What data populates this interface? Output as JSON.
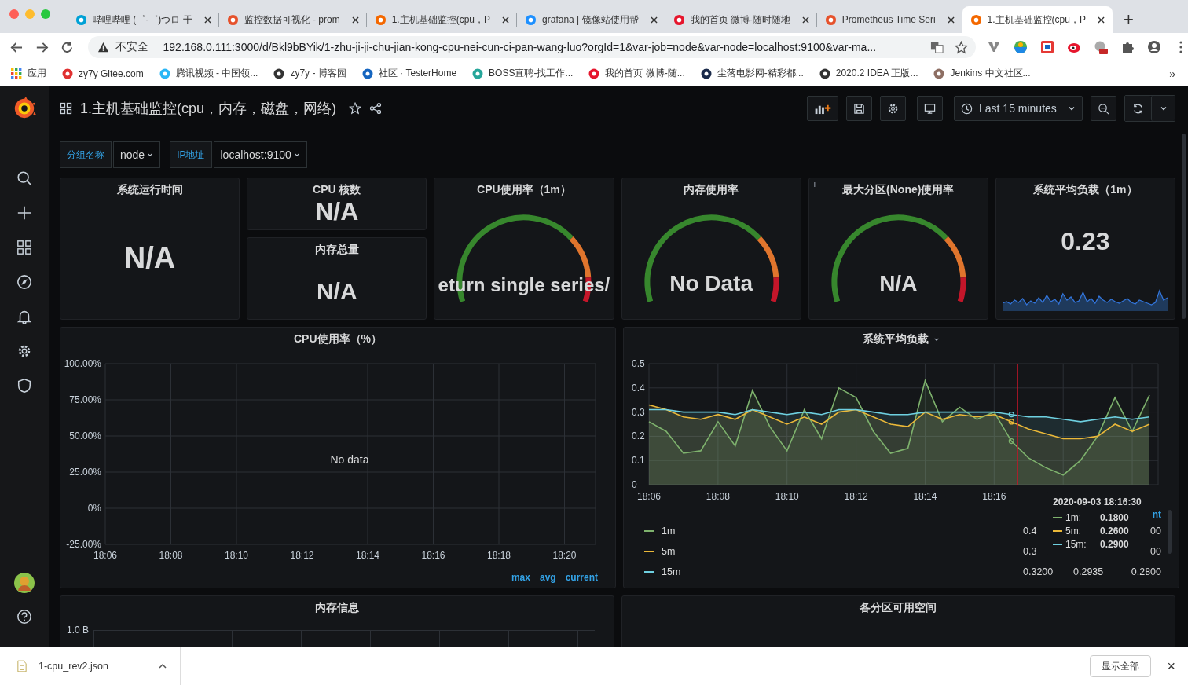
{
  "browser": {
    "tabs": [
      {
        "title": "哔哩哔哩 (゜-゜)つロ 干",
        "selected": false
      },
      {
        "title": "监控数据可视化 - prom",
        "selected": false
      },
      {
        "title": "1.主机基础监控(cpu，P",
        "selected": false
      },
      {
        "title": "grafana | 镜像站使用帮",
        "selected": false
      },
      {
        "title": "我的首页 微博-随时随地",
        "selected": false
      },
      {
        "title": "Prometheus Time Seri",
        "selected": false
      },
      {
        "title": "1.主机基础监控(cpu，P",
        "selected": true
      }
    ],
    "new_tab": "+",
    "address": {
      "security": "不安全",
      "url": "192.168.0.111:3000/d/Bkl9bBYik/1-zhu-ji-ji-chu-jian-kong-cpu-nei-cun-ci-pan-wang-luo?orgId=1&var-job=node&var-node=localhost:9100&var-ma..."
    },
    "bookmarks": [
      "应用",
      "zy7y  Gitee.com",
      "腾讯视频 - 中国领...",
      "zy7y - 博客园",
      "社区 · TesterHome",
      "BOSS直聘-找工作...",
      "我的首页 微博-随...",
      "尘落电影网-精彩都...",
      "2020.2 IDEA 正版...",
      "Jenkins 中文社区..."
    ],
    "bookmarks_more": "»"
  },
  "dashboard": {
    "title": "1.主机基础监控(cpu，内存，磁盘，网络)",
    "time_range": "Last 15 minutes",
    "variables": [
      {
        "label": "分组名称",
        "value": "node"
      },
      {
        "label": "IP地址",
        "value": "localhost:9100"
      }
    ]
  },
  "stat_panels": [
    {
      "kind": "stat",
      "title": "系统运行时间",
      "value": "N/A"
    },
    {
      "kind": "stack",
      "panels": [
        {
          "title": "CPU 核数",
          "value": "N/A"
        },
        {
          "title": "内存总量",
          "value": "N/A"
        }
      ]
    },
    {
      "kind": "gauge",
      "title": "CPU使用率（1m）",
      "value": "eturn single series/"
    },
    {
      "kind": "gauge",
      "title": "内存使用率",
      "value": "No Data"
    },
    {
      "kind": "gauge",
      "title": "最大分区(None)使用率",
      "value": "N/A",
      "info": "i"
    },
    {
      "kind": "sparkline",
      "title": "系统平均负载（1m）",
      "value": "0.23"
    }
  ],
  "cpu_graph": {
    "title": "CPU使用率（%）",
    "message": "No data",
    "legend_headers": [
      "max",
      "avg",
      "current"
    ],
    "chart_data": {
      "type": "line",
      "grid": true,
      "ylim": [
        -25,
        100
      ],
      "yticks": [
        {
          "value": 100,
          "label": "100.00%"
        },
        {
          "value": 75,
          "label": "75.00%"
        },
        {
          "value": 50,
          "label": "50.00%"
        },
        {
          "value": 25,
          "label": "25.00%"
        },
        {
          "value": 0,
          "label": "0%"
        },
        {
          "value": -25,
          "label": "-25.00%"
        }
      ],
      "categories": [
        "18:06",
        "18:08",
        "18:10",
        "18:12",
        "18:14",
        "18:16",
        "18:18",
        "18:20"
      ]
    }
  },
  "load_graph": {
    "title": "系统平均负载",
    "chart_data": {
      "type": "area",
      "grid": true,
      "ylim": [
        0,
        0.5
      ],
      "yticks": [
        0,
        0.1,
        0.2,
        0.3,
        0.4,
        0.5
      ],
      "categories": [
        "18:06",
        null,
        null,
        null,
        "18:08",
        null,
        null,
        null,
        "18:10",
        null,
        null,
        null,
        "18:12",
        null,
        null,
        null,
        "18:14",
        null,
        null,
        null,
        "18:16",
        null,
        null,
        null,
        null,
        null,
        null,
        null,
        null,
        null
      ],
      "series": [
        {
          "name": "1m",
          "color": "#7eb26d",
          "values": [
            0.26,
            0.22,
            0.13,
            0.14,
            0.26,
            0.16,
            0.39,
            0.24,
            0.14,
            0.31,
            0.19,
            0.4,
            0.36,
            0.22,
            0.13,
            0.15,
            0.43,
            0.26,
            0.32,
            0.27,
            0.3,
            0.18,
            0.11,
            0.07,
            0.04,
            0.1,
            0.2,
            0.36,
            0.22,
            0.37
          ]
        },
        {
          "name": "5m",
          "color": "#eab839",
          "values": [
            0.33,
            0.31,
            0.28,
            0.27,
            0.29,
            0.27,
            0.31,
            0.28,
            0.25,
            0.28,
            0.25,
            0.3,
            0.31,
            0.28,
            0.25,
            0.24,
            0.3,
            0.27,
            0.29,
            0.28,
            0.29,
            0.26,
            0.23,
            0.21,
            0.19,
            0.19,
            0.2,
            0.25,
            0.22,
            0.25
          ]
        },
        {
          "name": "15m",
          "color": "#6ed0e0",
          "values": [
            0.31,
            0.31,
            0.3,
            0.3,
            0.3,
            0.29,
            0.31,
            0.3,
            0.29,
            0.3,
            0.29,
            0.31,
            0.31,
            0.3,
            0.29,
            0.29,
            0.3,
            0.3,
            0.3,
            0.3,
            0.3,
            0.29,
            0.28,
            0.28,
            0.27,
            0.26,
            0.27,
            0.28,
            0.27,
            0.28
          ]
        }
      ]
    },
    "legend_header": "nt",
    "legend": [
      {
        "max": "0.4",
        "current": "00"
      },
      {
        "max": "0.3",
        "current": "00"
      },
      {
        "max": "0.3200",
        "avg": "0.2935",
        "current": "0.2800"
      }
    ],
    "tooltip": {
      "time": "2020-09-03 18:16:30",
      "rows": [
        {
          "label": "1m:",
          "value": "0.1800",
          "color": "#7eb26d"
        },
        {
          "label": "5m:",
          "value": "0.2600",
          "color": "#eab839"
        },
        {
          "label": "15m:",
          "value": "0.2900",
          "color": "#6ed0e0"
        }
      ]
    }
  },
  "memory_panel": {
    "title": "内存信息",
    "axis_label": "1.0 B"
  },
  "partition_panel": {
    "title": "各分区可用空间"
  },
  "downloads": {
    "file": "1-cpu_rev2.json",
    "show_all": "显示全部",
    "close": "×"
  }
}
